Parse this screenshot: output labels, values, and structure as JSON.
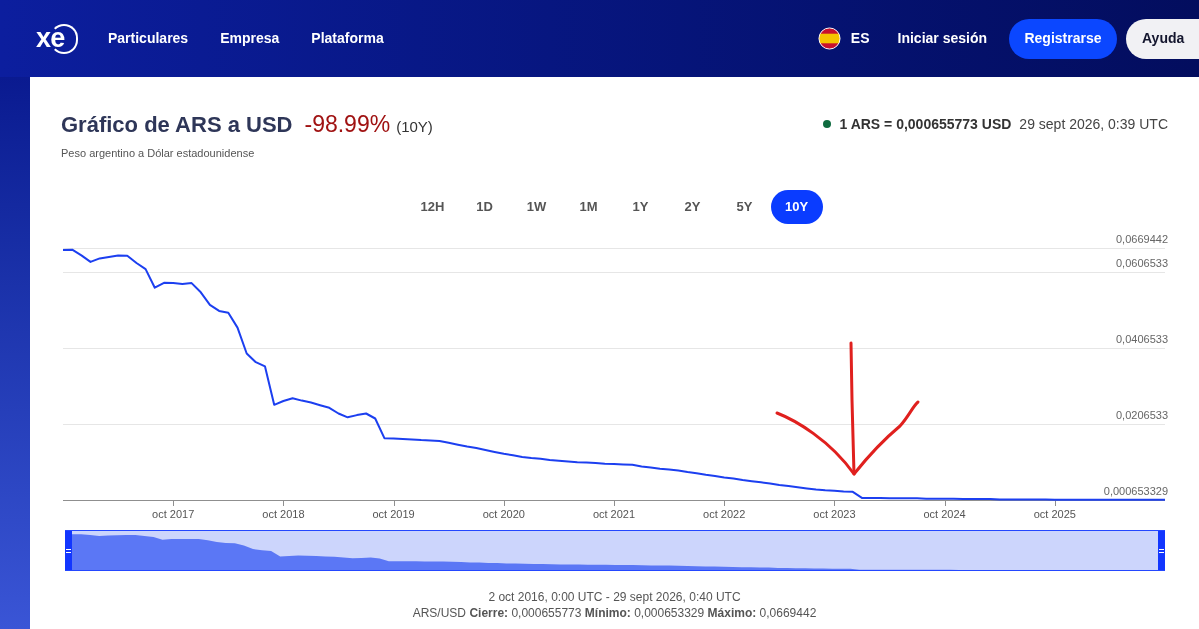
{
  "header": {
    "logo": "xe",
    "nav": [
      "Particulares",
      "Empresa",
      "Plataforma"
    ],
    "language": "ES",
    "login": "Iniciar sesión",
    "signup": "Registrarse",
    "help": "Ayuda"
  },
  "card": {
    "title": "Gráfico de ARS a USD",
    "change": "-98.99%",
    "period": "(10Y)",
    "subtitle": "Peso argentino a Dólar estadounidense",
    "rate": "1 ARS = 0,000655773 USD",
    "timestamp": "29 sept 2026, 0:39 UTC"
  },
  "tabs": [
    {
      "label": "12H",
      "selected": false
    },
    {
      "label": "1D",
      "selected": false
    },
    {
      "label": "1W",
      "selected": false
    },
    {
      "label": "1M",
      "selected": false
    },
    {
      "label": "1Y",
      "selected": false
    },
    {
      "label": "2Y",
      "selected": false
    },
    {
      "label": "5Y",
      "selected": false
    },
    {
      "label": "10Y",
      "selected": true
    }
  ],
  "chart": {
    "chart_data": {
      "type": "line",
      "grid": true,
      "categories": [
        null,
        null,
        null,
        null,
        null,
        null,
        null,
        null,
        null,
        null,
        null,
        null,
        "oct 2017",
        null,
        null,
        null,
        null,
        null,
        null,
        null,
        null,
        null,
        null,
        null,
        "oct 2018",
        null,
        null,
        null,
        null,
        null,
        null,
        null,
        null,
        null,
        null,
        null,
        "oct 2019",
        null,
        null,
        null,
        null,
        null,
        null,
        null,
        null,
        null,
        null,
        null,
        "oct 2020",
        null,
        null,
        null,
        null,
        null,
        null,
        null,
        null,
        null,
        null,
        null,
        "oct 2021",
        null,
        null,
        null,
        null,
        null,
        null,
        null,
        null,
        null,
        null,
        null,
        "oct 2022",
        null,
        null,
        null,
        null,
        null,
        null,
        null,
        null,
        null,
        null,
        null,
        "oct 2023",
        null,
        null,
        null,
        null,
        null,
        null,
        null,
        null,
        null,
        null,
        null,
        "oct 2024",
        null,
        null,
        null,
        null,
        null,
        null,
        null,
        null,
        null,
        null,
        null,
        "oct 2025",
        null,
        null,
        null,
        null,
        null,
        null,
        null,
        null,
        null,
        null,
        null,
        null
      ],
      "values": [
        0.0664,
        0.0665,
        0.065,
        0.0633,
        0.0642,
        0.0646,
        0.065,
        0.0649,
        0.063,
        0.0614,
        0.0565,
        0.0578,
        0.0577,
        0.0575,
        0.0577,
        0.0553,
        0.052,
        0.0504,
        0.0499,
        0.046,
        0.0392,
        0.0369,
        0.0358,
        0.0257,
        0.0267,
        0.0274,
        0.0268,
        0.0263,
        0.0256,
        0.0249,
        0.0234,
        0.0224,
        0.023,
        0.0234,
        0.0221,
        0.0169,
        0.0168,
        0.0167,
        0.0166,
        0.0164,
        0.0163,
        0.0162,
        0.0157,
        0.0152,
        0.0147,
        0.0143,
        0.0138,
        0.0133,
        0.0128,
        0.0124,
        0.012,
        0.0117,
        0.0115,
        0.0112,
        0.011,
        0.0108,
        0.0106,
        0.0105,
        0.0104,
        0.0102,
        0.0101,
        0.01,
        0.0099,
        0.0095,
        0.0092,
        0.0089,
        0.0087,
        0.0084,
        0.008,
        0.0077,
        0.0073,
        0.007,
        0.0066,
        0.0063,
        0.0059,
        0.0056,
        0.0053,
        0.005,
        0.0046,
        0.0043,
        0.004,
        0.0037,
        0.0034,
        0.0032,
        0.0031,
        0.0029,
        0.0028,
        0.0012,
        0.0012,
        0.0012,
        0.0011,
        0.0011,
        0.0011,
        0.0011,
        0.001,
        0.001,
        0.001,
        0.001,
        0.0009,
        0.0009,
        0.0009,
        0.0009,
        0.0008,
        0.0008,
        0.0008,
        0.0008,
        0.0008,
        0.0008,
        0.0007,
        0.0007,
        0.0007,
        0.0007,
        0.0007,
        0.0007,
        0.0007,
        0.0007,
        0.0007,
        0.0007,
        0.0007,
        0.0007,
        0.0007
      ],
      "ylim": [
        0.000653329,
        0.0669442
      ],
      "yticks": [
        {
          "value": 0.000653329,
          "label": "0,000653329"
        },
        {
          "value": 0.0206533,
          "label": "0,0206533"
        },
        {
          "value": 0.0406533,
          "label": "0,0406533"
        },
        {
          "value": 0.0606533,
          "label": "0,0606533"
        },
        {
          "value": 0.0669442,
          "label": "0,0669442"
        }
      ]
    }
  },
  "footer": {
    "range": "2 oct 2016, 0:00 UTC - 29 sept 2026, 0:40 UTC",
    "stats": "ARS/USD **Cierre:** 0,000655773 **Mínimo:** 0,000653329 **Máximo:** 0,0669442"
  }
}
